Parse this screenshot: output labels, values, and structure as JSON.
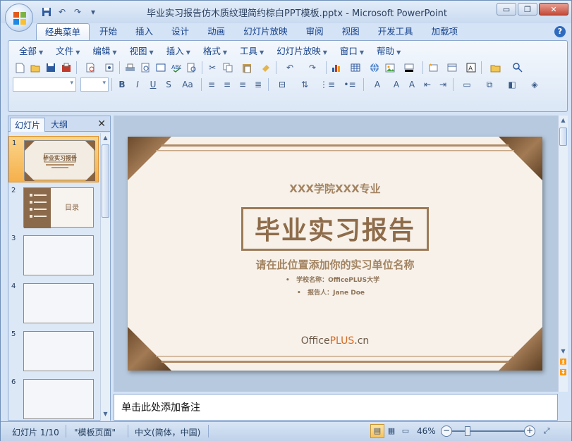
{
  "window": {
    "title": "毕业实习报告仿木质纹理简约棕白PPT模板.pptx - Microsoft PowerPoint",
    "controls": {
      "minimize": "▭",
      "restore": "❐",
      "close": "✕"
    }
  },
  "quick_access": [
    "save-icon",
    "undo-icon",
    "redo-icon",
    "customize-icon"
  ],
  "ribbon_tabs": [
    {
      "label": "经典菜单",
      "active": true
    },
    {
      "label": "开始"
    },
    {
      "label": "插入"
    },
    {
      "label": "设计"
    },
    {
      "label": "动画"
    },
    {
      "label": "幻灯片放映"
    },
    {
      "label": "审阅"
    },
    {
      "label": "视图"
    },
    {
      "label": "开发工具"
    },
    {
      "label": "加载项"
    }
  ],
  "menus": [
    "全部",
    "文件",
    "编辑",
    "视图",
    "插入",
    "格式",
    "工具",
    "幻灯片放映",
    "窗口",
    "帮助"
  ],
  "slides_panel": {
    "tab_slides": "幻灯片",
    "tab_outline": "大纲",
    "close": "✕",
    "numbers": [
      "1",
      "2",
      "3",
      "4",
      "5",
      "6"
    ],
    "thumb1_title": "毕业实习报告",
    "thumb2_title": "目录"
  },
  "slide": {
    "subtitle": "XXX学院XXX专业",
    "title": "毕业实习报告",
    "tagline": "请在此位置添加你的实习单位名称",
    "school": "学校名称：OfficePLUS大学",
    "reporter": "报告人：Jane Doe",
    "brand_a": "Office",
    "brand_b": "PLUS",
    "brand_c": ".cn"
  },
  "notes_placeholder": "单击此处添加备注",
  "status": {
    "slide_counter": "幻灯片 1/10",
    "theme": "\"模板页面\"",
    "language": "中文(简体，中国)",
    "zoom": "46%"
  }
}
